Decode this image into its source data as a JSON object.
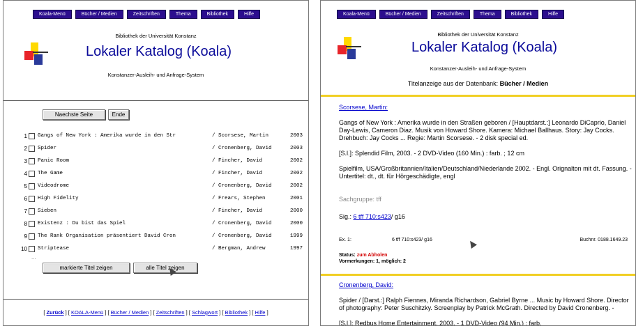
{
  "nav": [
    "Koala-Menü",
    "Bücher / Medien",
    "Zeitschriften",
    "Thema",
    "Bibliothek",
    "Hilfe"
  ],
  "header": {
    "institution": "Bibliothek der Universität Konstanz",
    "title": "Lokaler Katalog (Koala)",
    "subtitle": "Konstanzer-Ausleih- und Anfrage-System"
  },
  "left": {
    "buttons": {
      "next": "Naechste Seite",
      "end": "Ende",
      "show_marked": "markierte Titel zeigen",
      "show_all": "alle Titel zeigen"
    },
    "results": [
      {
        "num": "1",
        "title": "Gangs of New York : Amerika wurde in den Str",
        "author": "/ Scorsese, Martin",
        "year": "2003"
      },
      {
        "num": "2",
        "title": "Spider",
        "author": "/ Cronenberg, David",
        "year": "2003"
      },
      {
        "num": "3",
        "title": "Panic Room",
        "author": "/ Fincher, David",
        "year": "2002"
      },
      {
        "num": "4",
        "title": "The Game",
        "author": "/ Fincher, David",
        "year": "2002"
      },
      {
        "num": "5",
        "title": "Videodrome",
        "author": "/ Cronenberg, David",
        "year": "2002"
      },
      {
        "num": "6",
        "title": "High Fidelity",
        "author": "/ Frears, Stephen",
        "year": "2001"
      },
      {
        "num": "7",
        "title": "Sieben",
        "author": "/ Fincher, David",
        "year": "2000"
      },
      {
        "num": "8",
        "title": "Existenz : Du bist das Spiel",
        "author": "/ Cronenberg, David",
        "year": "2000"
      },
      {
        "num": "9",
        "title": "The Rank Organisation präsentiert David Cron",
        "author": "/ Cronenberg, David",
        "year": "1999"
      },
      {
        "num": "10",
        "title": "Striptease",
        "author": "/ Bergman, Andrew",
        "year": "1997"
      }
    ],
    "dots": "...",
    "footer": [
      "Zurück",
      "KOALA-Menü",
      "Bücher / Medien",
      "Zeitschriften",
      "Schlagwort",
      "Bibliothek",
      "Hilfe"
    ]
  },
  "right": {
    "view_prefix": "Titelanzeige aus der Datenbank:",
    "view_db": "Bücher / Medien",
    "author1": "Scorsese, Martin:",
    "desc1": "Gangs of New York : Amerika wurde in den Straßen geboren / [Hauptdarst.:] Leonardo DiCaprio, Daniel Day-Lewis, Cameron Diaz. Musik von Howard Shore. Kamera: Michael Ballhaus. Story: Jay Cocks. Drehbuch: Jay Cocks ... Regie: Martin Scorsese. - 2 disk special ed.",
    "pub1": "[S.l.]: Splendid Film, 2003. - 2 DVD-Video (160 Min.) : farb. ; 12 cm",
    "note1": "Spielfilm, USA/Großbritannien/Italien/Deutschland/Niederlande 2002. - Engl. Orignalton mit dt. Fassung. - Untertitel: dt., dt. für Hörgeschädigte, engl",
    "group_label": "Sachgruppe:",
    "group_value": "tff",
    "sig_label": "Sig.:",
    "sig_link": "6 tff 710:s423",
    "sig_rest": "/ g16",
    "ex_label": "Ex. 1:",
    "ex_sig": "6 tff 710:s423/ g16",
    "buchnr": "Buchnr. 0188.1649.23",
    "status_label": "Status:",
    "status_value": "zum Abholen",
    "vormerk": "Vormerkungen: 1, möglich: 2",
    "author2": "Cronenberg, David:",
    "desc2": "Spider / [Darst.:] Ralph Fiennes, Miranda Richardson, Gabriel Byrne ... Music by Howard Shore. Director of photography: Peter Suschitzky. Screenplay by Patrick McGrath. Directed by David Cronenberg. -",
    "pub2": "[S.l.]: Redbus Home Entertainment, 2003. - 1 DVD-Video (94 Min.) : farb."
  }
}
